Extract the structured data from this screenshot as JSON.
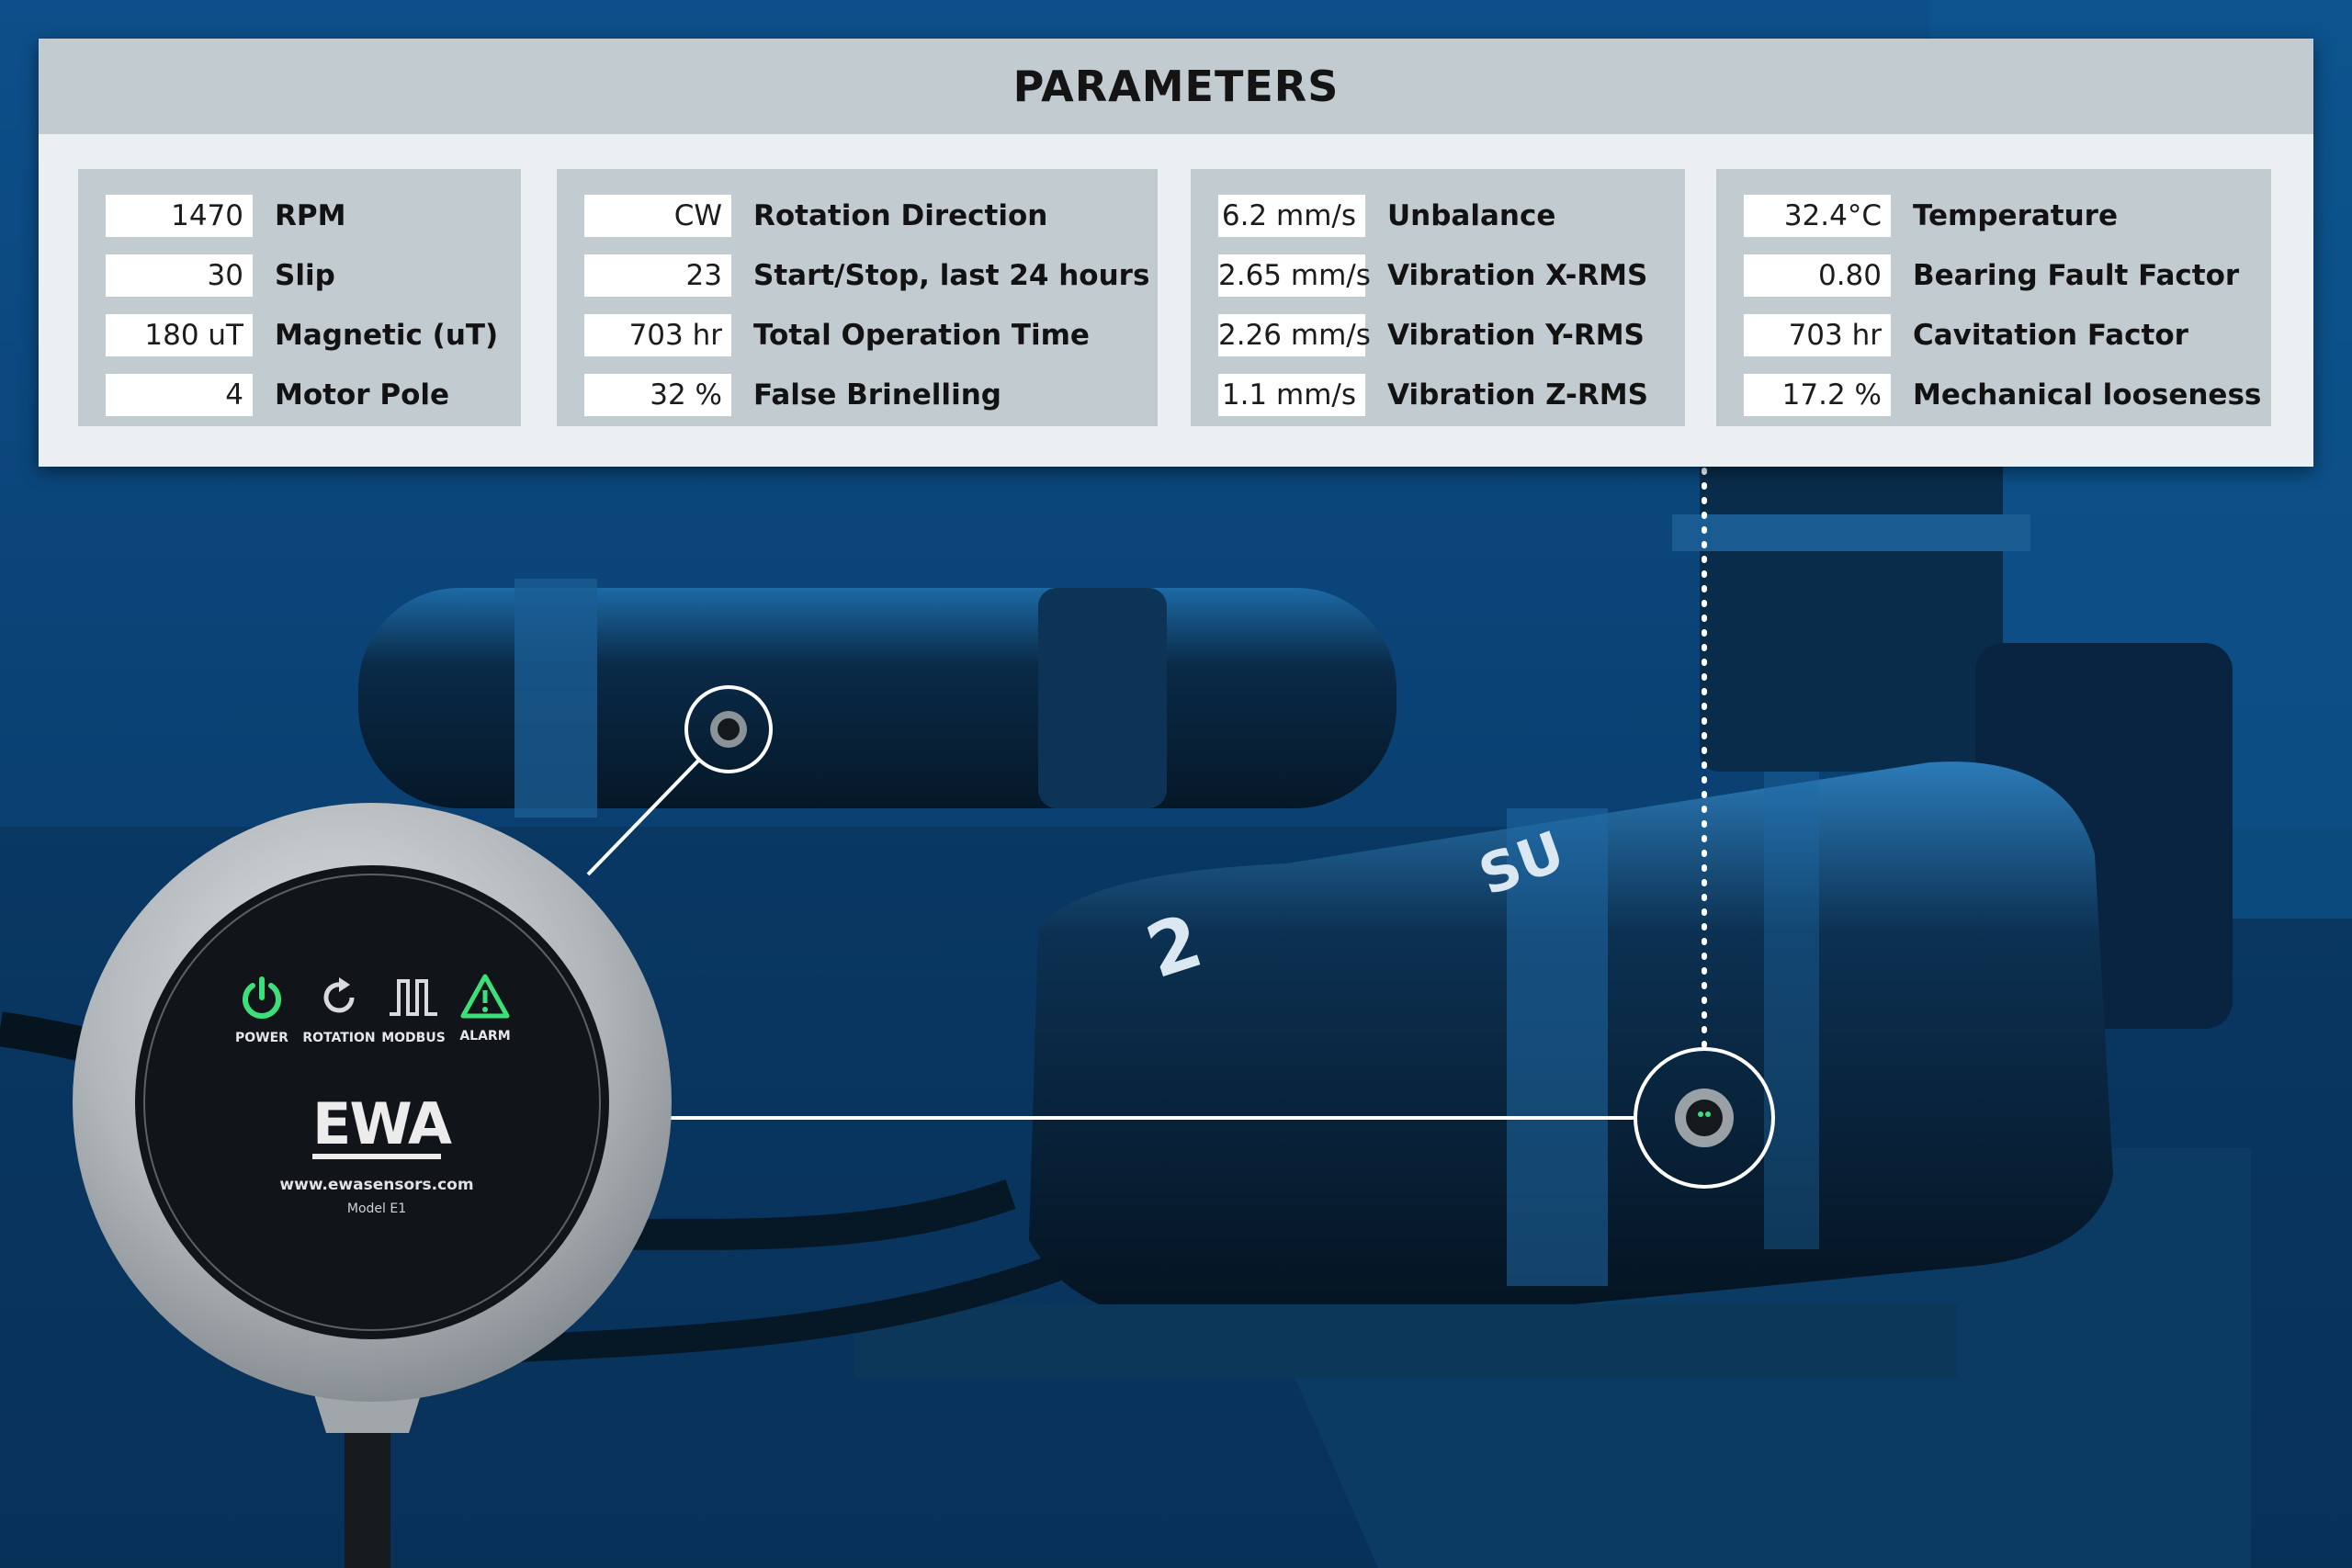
{
  "panel": {
    "title": "PARAMETERS",
    "groups": [
      {
        "rows": [
          {
            "value": "1470",
            "label": "RPM"
          },
          {
            "value": "30",
            "label": "Slip"
          },
          {
            "value": "180 uT",
            "label": "Magnetic (uT)"
          },
          {
            "value": "4",
            "label": "Motor Pole"
          }
        ]
      },
      {
        "rows": [
          {
            "value": "CW",
            "label": "Rotation Direction"
          },
          {
            "value": "23",
            "label": "Start/Stop, last 24 hours"
          },
          {
            "value": "703 hr",
            "label": "Total Operation Time"
          },
          {
            "value": "32 %",
            "label": "False Brinelling"
          }
        ]
      },
      {
        "rows": [
          {
            "value": "6.2 mm/s",
            "label": "Unbalance"
          },
          {
            "value": "2.65 mm/s",
            "label": "Vibration X-RMS"
          },
          {
            "value": "2.26 mm/s",
            "label": "Vibration Y-RMS"
          },
          {
            "value": "1.1 mm/s",
            "label": "Vibration Z-RMS"
          }
        ]
      },
      {
        "rows": [
          {
            "value": "32.4°C",
            "label": "Temperature"
          },
          {
            "value": "0.80",
            "label": "Bearing Fault Factor"
          },
          {
            "value": "703 hr",
            "label": "Cavitation Factor"
          },
          {
            "value": "17.2 %",
            "label": "Mechanical looseness"
          }
        ]
      }
    ]
  },
  "device": {
    "indicators": [
      {
        "label": "POWER",
        "icon": "power-icon"
      },
      {
        "label": "ROTATION",
        "icon": "rotation-icon"
      },
      {
        "label": "MODBUS",
        "icon": "modbus-icon"
      },
      {
        "label": "ALARM",
        "icon": "alarm-icon"
      }
    ],
    "logo_text": "EWA",
    "website": "www.ewasensors.com",
    "model": "Model E1",
    "pump_mark": "SU",
    "pump_number": "2"
  },
  "colors": {
    "scene_blue": "#0b4a80",
    "panel_header": "#c2ccd0",
    "panel_bg": "#eceff1",
    "led_green": "#3be07a",
    "device_face": "#111418",
    "device_ring": "#b4b9bd"
  }
}
